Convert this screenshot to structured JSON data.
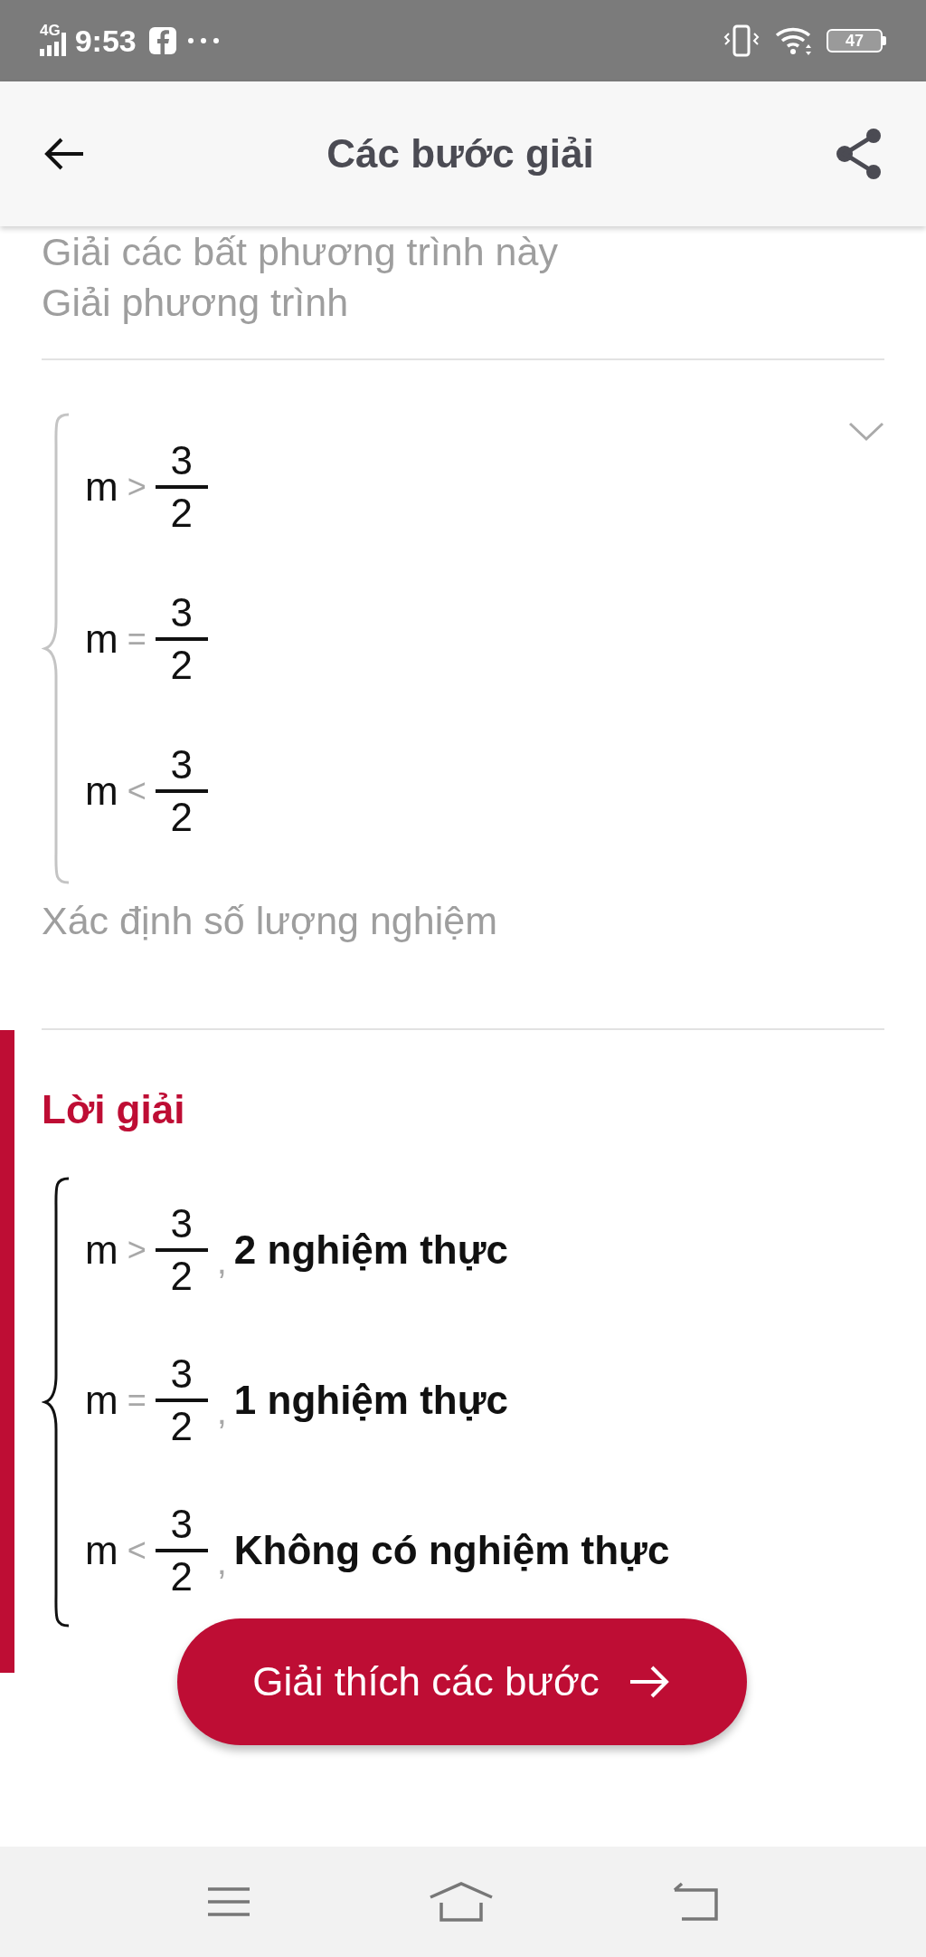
{
  "status_bar": {
    "network": "4G",
    "time": "9:53",
    "battery": "47"
  },
  "header": {
    "title": "Các bước giải"
  },
  "previous_step": {
    "lines": [
      "Giải các bất phương trình này",
      "Giải phương trình"
    ]
  },
  "step": {
    "expanded": false,
    "system": [
      {
        "lhs": "m",
        "relation": ">",
        "numerator": "3",
        "denominator": "2"
      },
      {
        "lhs": "m",
        "relation": "=",
        "numerator": "3",
        "denominator": "2"
      },
      {
        "lhs": "m",
        "relation": "<",
        "numerator": "3",
        "denominator": "2"
      }
    ],
    "caption": "Xác định số lượng nghiệm"
  },
  "solution": {
    "title": "Lời giải",
    "system": [
      {
        "lhs": "m",
        "relation": ">",
        "numerator": "3",
        "denominator": "2",
        "separator": ",",
        "result": "2 nghiệm thực"
      },
      {
        "lhs": "m",
        "relation": "=",
        "numerator": "3",
        "denominator": "2",
        "separator": ",",
        "result": "1 nghiệm thực"
      },
      {
        "lhs": "m",
        "relation": "<",
        "numerator": "3",
        "denominator": "2",
        "separator": ",",
        "result": "Không có nghiệm thực"
      }
    ]
  },
  "explain_button": {
    "label": "Giải thích các bước"
  }
}
